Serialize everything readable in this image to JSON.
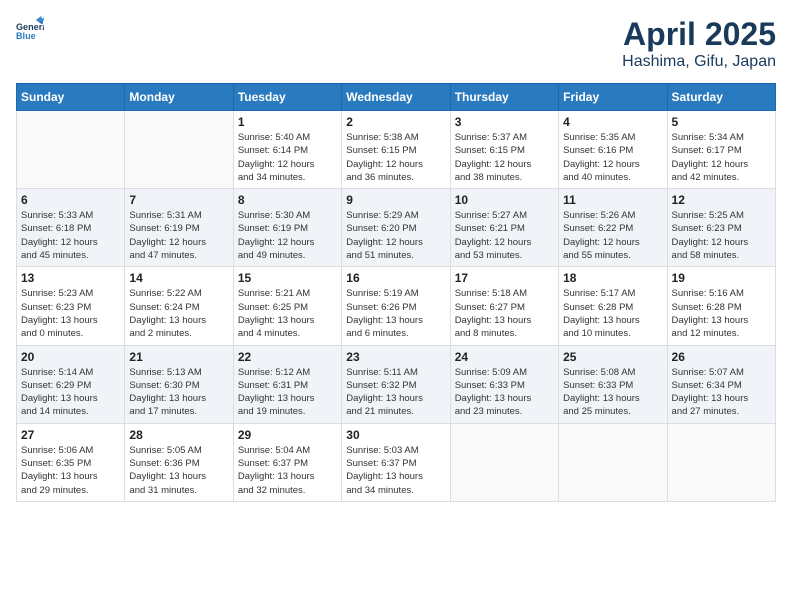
{
  "header": {
    "logo_line1": "General",
    "logo_line2": "Blue",
    "month_title": "April 2025",
    "location": "Hashima, Gifu, Japan"
  },
  "days_of_week": [
    "Sunday",
    "Monday",
    "Tuesday",
    "Wednesday",
    "Thursday",
    "Friday",
    "Saturday"
  ],
  "weeks": [
    [
      {
        "day": "",
        "info": ""
      },
      {
        "day": "",
        "info": ""
      },
      {
        "day": "1",
        "info": "Sunrise: 5:40 AM\nSunset: 6:14 PM\nDaylight: 12 hours\nand 34 minutes."
      },
      {
        "day": "2",
        "info": "Sunrise: 5:38 AM\nSunset: 6:15 PM\nDaylight: 12 hours\nand 36 minutes."
      },
      {
        "day": "3",
        "info": "Sunrise: 5:37 AM\nSunset: 6:15 PM\nDaylight: 12 hours\nand 38 minutes."
      },
      {
        "day": "4",
        "info": "Sunrise: 5:35 AM\nSunset: 6:16 PM\nDaylight: 12 hours\nand 40 minutes."
      },
      {
        "day": "5",
        "info": "Sunrise: 5:34 AM\nSunset: 6:17 PM\nDaylight: 12 hours\nand 42 minutes."
      }
    ],
    [
      {
        "day": "6",
        "info": "Sunrise: 5:33 AM\nSunset: 6:18 PM\nDaylight: 12 hours\nand 45 minutes."
      },
      {
        "day": "7",
        "info": "Sunrise: 5:31 AM\nSunset: 6:19 PM\nDaylight: 12 hours\nand 47 minutes."
      },
      {
        "day": "8",
        "info": "Sunrise: 5:30 AM\nSunset: 6:19 PM\nDaylight: 12 hours\nand 49 minutes."
      },
      {
        "day": "9",
        "info": "Sunrise: 5:29 AM\nSunset: 6:20 PM\nDaylight: 12 hours\nand 51 minutes."
      },
      {
        "day": "10",
        "info": "Sunrise: 5:27 AM\nSunset: 6:21 PM\nDaylight: 12 hours\nand 53 minutes."
      },
      {
        "day": "11",
        "info": "Sunrise: 5:26 AM\nSunset: 6:22 PM\nDaylight: 12 hours\nand 55 minutes."
      },
      {
        "day": "12",
        "info": "Sunrise: 5:25 AM\nSunset: 6:23 PM\nDaylight: 12 hours\nand 58 minutes."
      }
    ],
    [
      {
        "day": "13",
        "info": "Sunrise: 5:23 AM\nSunset: 6:23 PM\nDaylight: 13 hours\nand 0 minutes."
      },
      {
        "day": "14",
        "info": "Sunrise: 5:22 AM\nSunset: 6:24 PM\nDaylight: 13 hours\nand 2 minutes."
      },
      {
        "day": "15",
        "info": "Sunrise: 5:21 AM\nSunset: 6:25 PM\nDaylight: 13 hours\nand 4 minutes."
      },
      {
        "day": "16",
        "info": "Sunrise: 5:19 AM\nSunset: 6:26 PM\nDaylight: 13 hours\nand 6 minutes."
      },
      {
        "day": "17",
        "info": "Sunrise: 5:18 AM\nSunset: 6:27 PM\nDaylight: 13 hours\nand 8 minutes."
      },
      {
        "day": "18",
        "info": "Sunrise: 5:17 AM\nSunset: 6:28 PM\nDaylight: 13 hours\nand 10 minutes."
      },
      {
        "day": "19",
        "info": "Sunrise: 5:16 AM\nSunset: 6:28 PM\nDaylight: 13 hours\nand 12 minutes."
      }
    ],
    [
      {
        "day": "20",
        "info": "Sunrise: 5:14 AM\nSunset: 6:29 PM\nDaylight: 13 hours\nand 14 minutes."
      },
      {
        "day": "21",
        "info": "Sunrise: 5:13 AM\nSunset: 6:30 PM\nDaylight: 13 hours\nand 17 minutes."
      },
      {
        "day": "22",
        "info": "Sunrise: 5:12 AM\nSunset: 6:31 PM\nDaylight: 13 hours\nand 19 minutes."
      },
      {
        "day": "23",
        "info": "Sunrise: 5:11 AM\nSunset: 6:32 PM\nDaylight: 13 hours\nand 21 minutes."
      },
      {
        "day": "24",
        "info": "Sunrise: 5:09 AM\nSunset: 6:33 PM\nDaylight: 13 hours\nand 23 minutes."
      },
      {
        "day": "25",
        "info": "Sunrise: 5:08 AM\nSunset: 6:33 PM\nDaylight: 13 hours\nand 25 minutes."
      },
      {
        "day": "26",
        "info": "Sunrise: 5:07 AM\nSunset: 6:34 PM\nDaylight: 13 hours\nand 27 minutes."
      }
    ],
    [
      {
        "day": "27",
        "info": "Sunrise: 5:06 AM\nSunset: 6:35 PM\nDaylight: 13 hours\nand 29 minutes."
      },
      {
        "day": "28",
        "info": "Sunrise: 5:05 AM\nSunset: 6:36 PM\nDaylight: 13 hours\nand 31 minutes."
      },
      {
        "day": "29",
        "info": "Sunrise: 5:04 AM\nSunset: 6:37 PM\nDaylight: 13 hours\nand 32 minutes."
      },
      {
        "day": "30",
        "info": "Sunrise: 5:03 AM\nSunset: 6:37 PM\nDaylight: 13 hours\nand 34 minutes."
      },
      {
        "day": "",
        "info": ""
      },
      {
        "day": "",
        "info": ""
      },
      {
        "day": "",
        "info": ""
      }
    ]
  ]
}
